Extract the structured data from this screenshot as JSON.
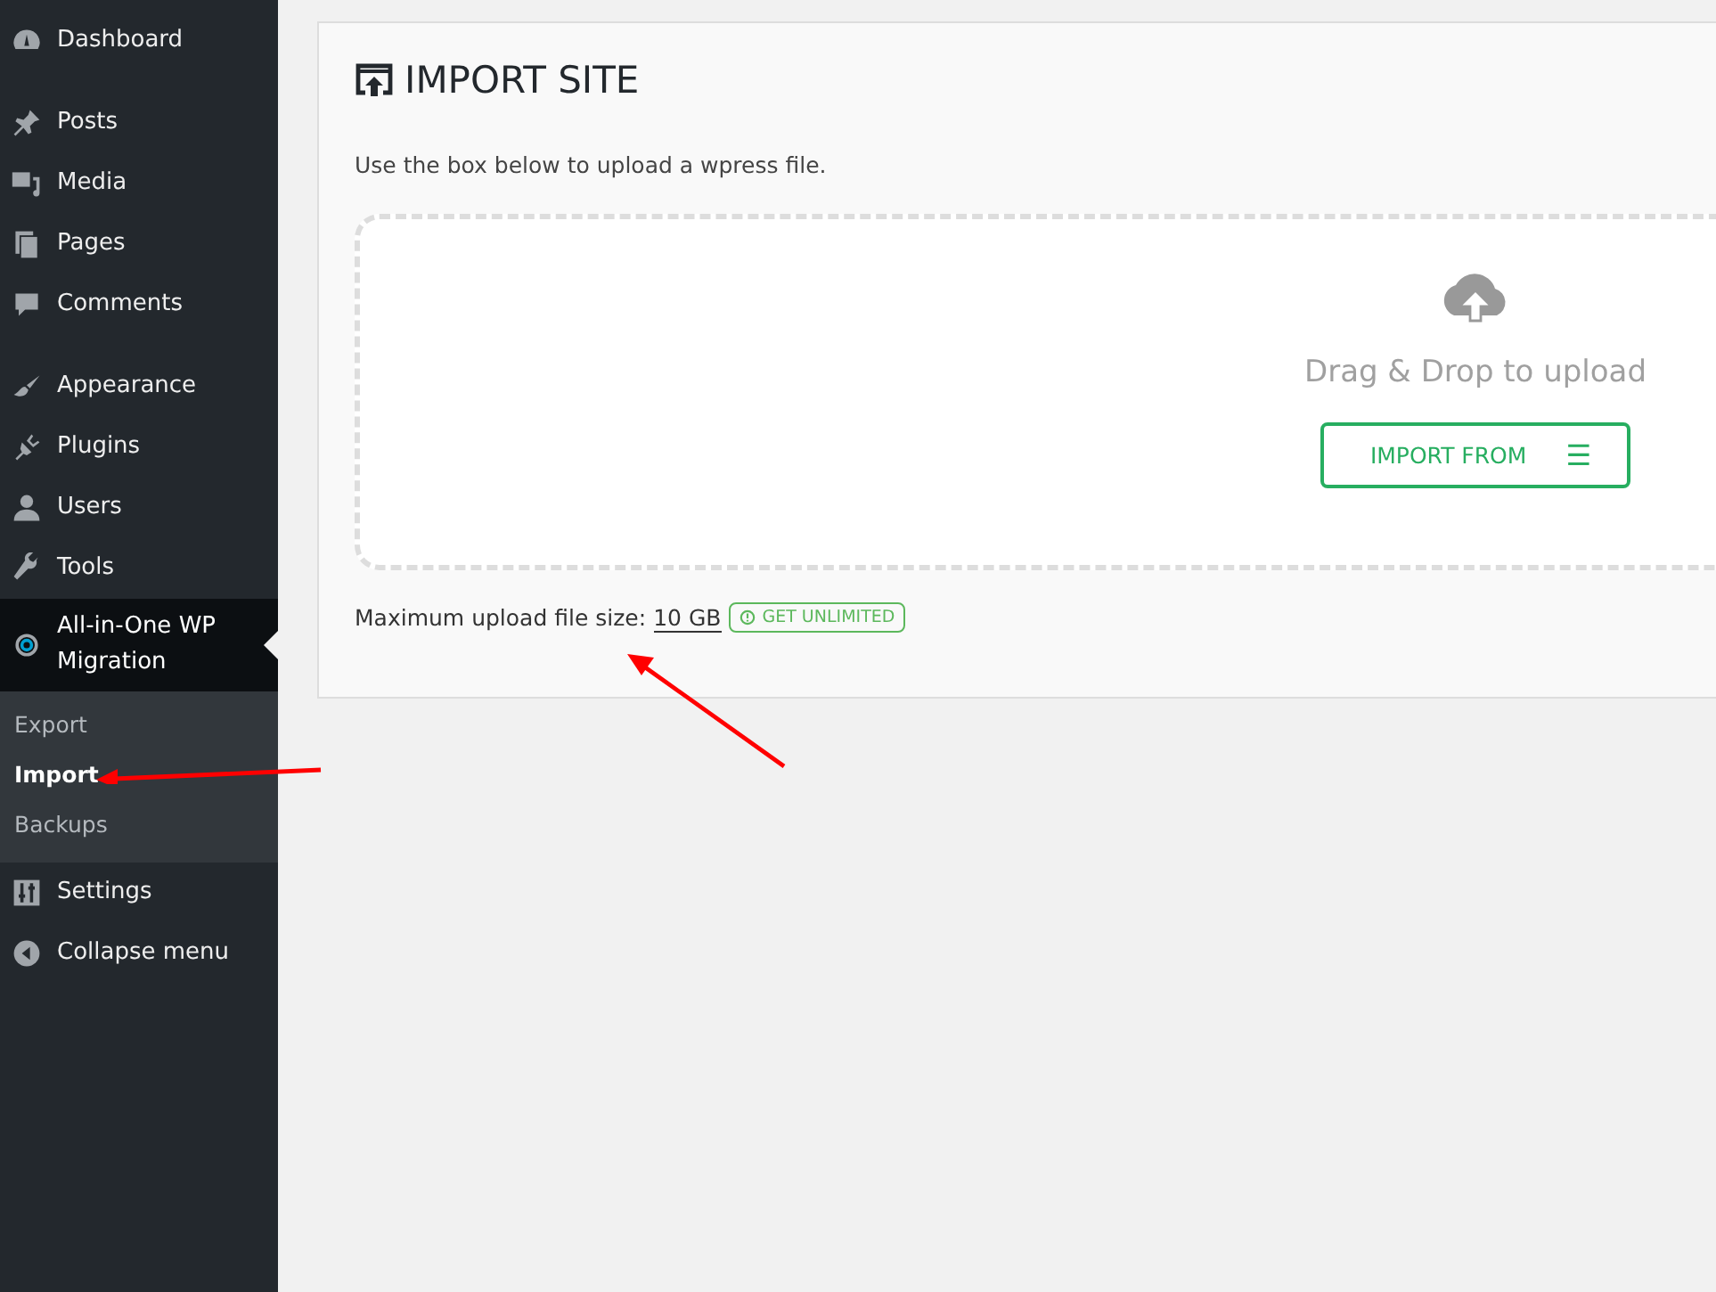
{
  "sidebar": {
    "groups": [
      [
        {
          "label": "Dashboard",
          "selected": false
        }
      ],
      [
        {
          "label": "Posts",
          "selected": false
        },
        {
          "label": "Media",
          "selected": false
        },
        {
          "label": "Pages",
          "selected": false
        },
        {
          "label": "Comments",
          "selected": false
        }
      ],
      [
        {
          "label": "Appearance",
          "selected": false
        },
        {
          "label": "Plugins",
          "selected": false
        },
        {
          "label": "Users",
          "selected": false
        },
        {
          "label": "Tools",
          "selected": false
        },
        {
          "label": "All-in-One WP Migration",
          "selected": true,
          "children": [
            {
              "label": "Export",
              "selected": false
            },
            {
              "label": "Import",
              "selected": true
            },
            {
              "label": "Backups",
              "selected": false
            }
          ]
        },
        {
          "label": "Settings",
          "selected": false
        },
        {
          "label": "Collapse menu",
          "selected": false
        }
      ]
    ]
  },
  "panel": {
    "title": "IMPORT SITE",
    "description": "Use the box below to upload a wpress file.",
    "dropzone": {
      "text": "Drag & Drop to upload",
      "button": "IMPORT FROM",
      "button_icon": "☰"
    },
    "max_size_label": "Maximum upload file size:",
    "max_size": "10 GB",
    "badge": "GET UNLIMITED"
  }
}
